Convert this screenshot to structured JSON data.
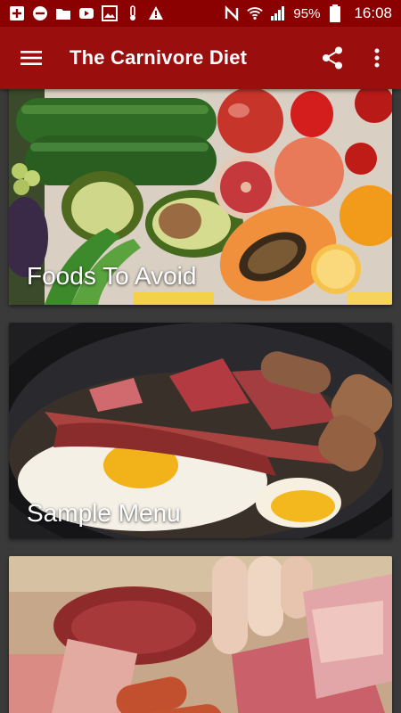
{
  "status_bar": {
    "battery": "95%",
    "time": "16:08",
    "left_icons": [
      "add-box-icon",
      "minus-circle-icon",
      "folder-icon",
      "youtube-icon",
      "image-icon",
      "thermometer-icon",
      "warning-icon"
    ],
    "right_icons": [
      "nfc-icon",
      "wifi-icon",
      "signal-icon",
      "battery-icon"
    ]
  },
  "app_bar": {
    "title": "The Carnivore Diet",
    "menu_icon": "hamburger-menu-icon",
    "share_icon": "share-icon",
    "overflow_icon": "more-vert-icon"
  },
  "cards": [
    {
      "label": "Foods To Avoid"
    },
    {
      "label": "Sample Menu"
    },
    {
      "label": ""
    }
  ],
  "colors": {
    "status_bar": "#8b0000",
    "app_bar": "#9b0e0e",
    "background": "#3a3a3a"
  }
}
